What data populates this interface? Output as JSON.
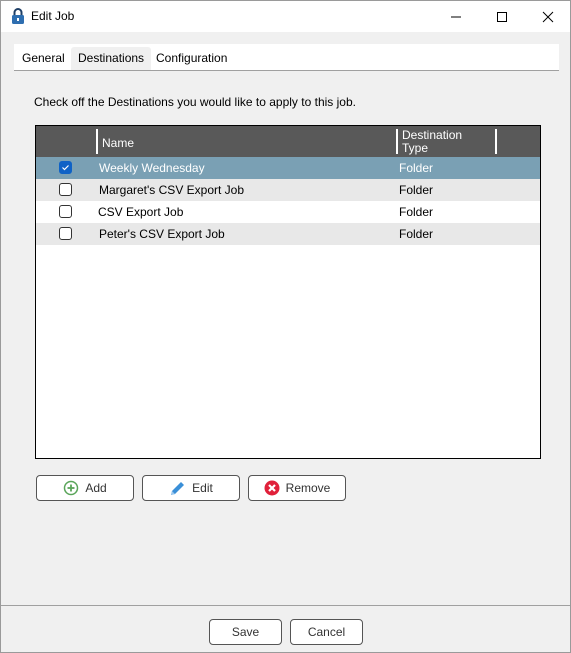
{
  "window": {
    "title": "Edit Job",
    "icon": "padlock-icon",
    "controls": [
      "minimize-icon",
      "maximize-icon",
      "close-icon"
    ]
  },
  "tabs": [
    {
      "label": "General",
      "active": false
    },
    {
      "label": "Destinations",
      "active": true
    },
    {
      "label": "Configuration",
      "active": false
    }
  ],
  "instructions": "Check off the Destinations you would like to apply to this job.",
  "grid": {
    "columns": {
      "checkbox": "",
      "name": "Name",
      "type_line1": "Destination",
      "type_line2": "Type"
    },
    "rows": [
      {
        "checked": true,
        "selected": true,
        "name": "Weekly Wednesday",
        "type": "Folder"
      },
      {
        "checked": false,
        "selected": false,
        "name": "Margaret's CSV Export Job",
        "type": "Folder"
      },
      {
        "checked": false,
        "selected": false,
        "name": "CSV Export Job",
        "type": "Folder"
      },
      {
        "checked": false,
        "selected": false,
        "name": "Peter's CSV Export Job",
        "type": "Folder"
      }
    ]
  },
  "actions": {
    "add": {
      "label": "Add",
      "icon": "plus-circle-icon"
    },
    "edit": {
      "label": "Edit",
      "icon": "pencil-icon"
    },
    "remove": {
      "label": "Remove",
      "icon": "remove-circle-icon"
    }
  },
  "footer": {
    "save": "Save",
    "cancel": "Cancel"
  },
  "colors": {
    "header_bg": "#595959",
    "selected_row": "#7aa0b4",
    "alt_row": "#e8e8e8",
    "checkbox_checked": "#0f62c6",
    "add_icon": "#5aa55a",
    "edit_icon": "#3a8fd8",
    "remove_icon": "#e0203a"
  }
}
